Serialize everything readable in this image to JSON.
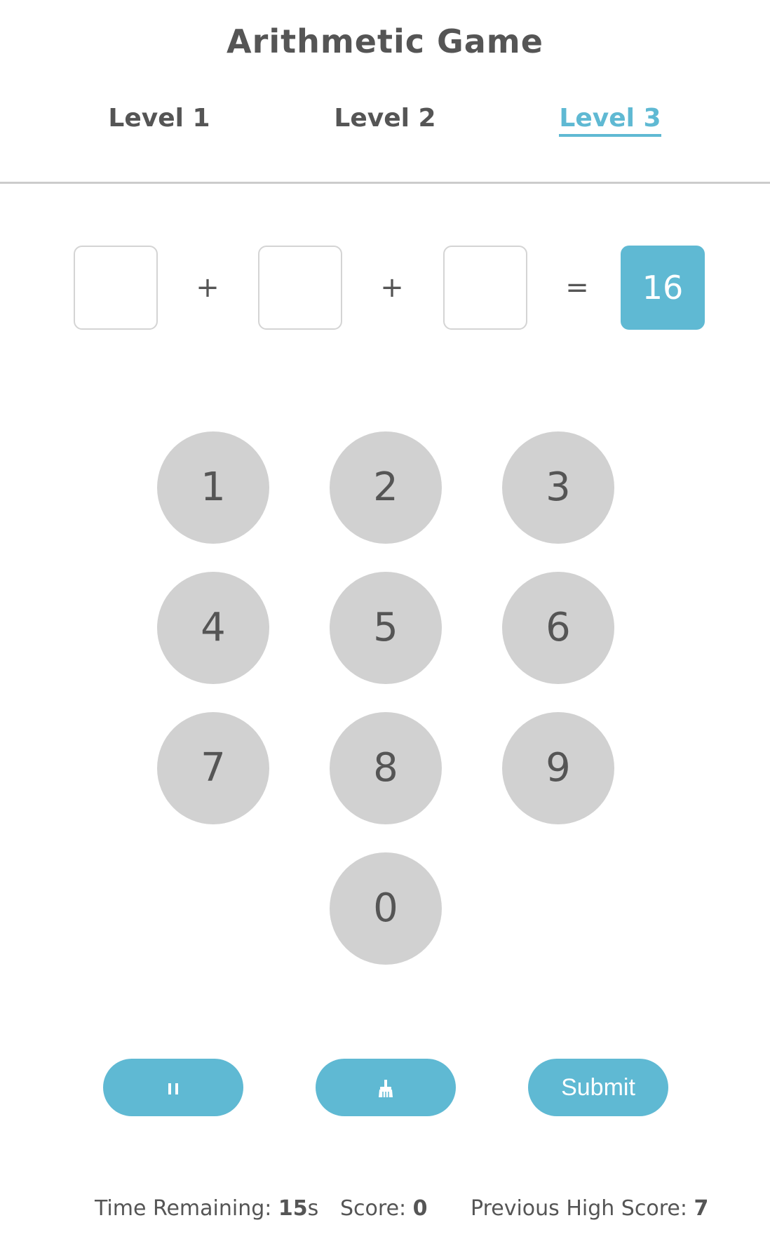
{
  "title": "Arithmetic Game",
  "levels": [
    {
      "label": "Level 1",
      "active": false
    },
    {
      "label": "Level 2",
      "active": false
    },
    {
      "label": "Level 3",
      "active": true
    }
  ],
  "equation": {
    "operators": [
      "+",
      "+",
      "="
    ],
    "target": "16"
  },
  "keypad": [
    "1",
    "2",
    "3",
    "4",
    "5",
    "6",
    "7",
    "8",
    "9",
    "0"
  ],
  "controls": {
    "pause_icon": "pause-icon",
    "clear_icon": "broom-icon",
    "submit_label": "Submit"
  },
  "status": {
    "time_label": "Time Remaining: ",
    "time_value": "15",
    "time_unit": "s",
    "score_label": "Score: ",
    "score_value": "0",
    "high_label": "Previous High Score: ",
    "high_value": "7"
  },
  "colors": {
    "accent": "#5fb9d3",
    "key": "#d1d1d1",
    "text": "#555555"
  }
}
